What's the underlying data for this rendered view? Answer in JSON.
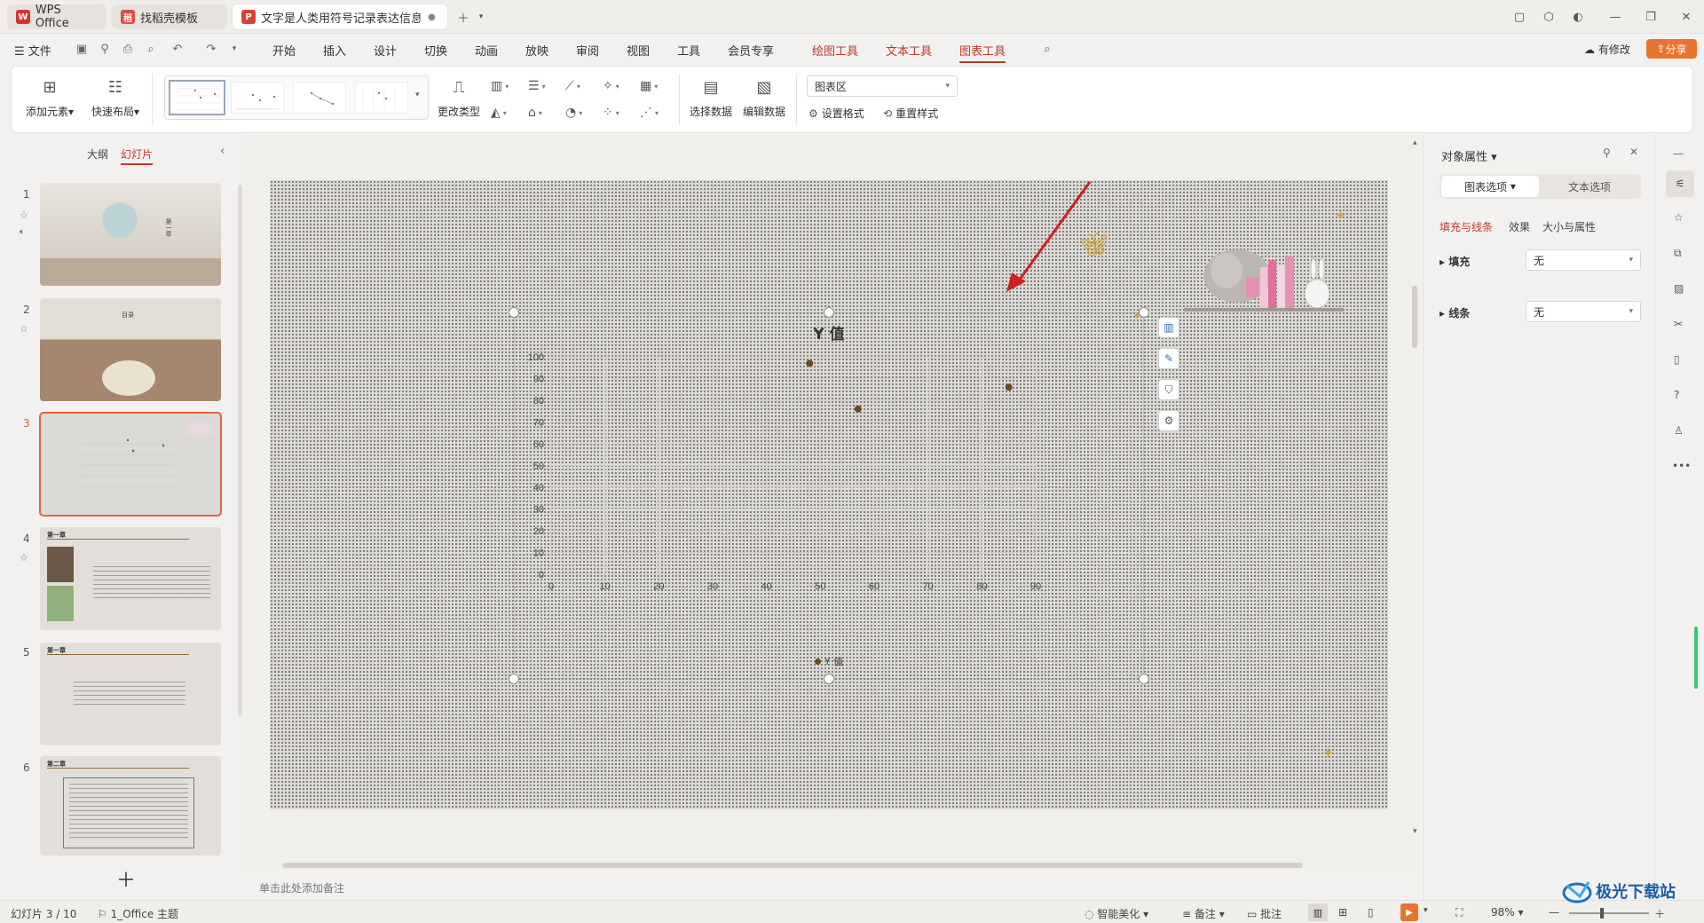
{
  "titlebar": {
    "tabs": [
      {
        "label": "WPS Office"
      },
      {
        "label": "找稻壳模板"
      },
      {
        "label": "文字是人类用符号记录表达信息以"
      }
    ]
  },
  "menubar": {
    "file": "文件",
    "items": [
      "开始",
      "插入",
      "设计",
      "切换",
      "动画",
      "放映",
      "审阅",
      "视图",
      "工具",
      "会员专享"
    ],
    "context_items": [
      "绘图工具",
      "文本工具",
      "图表工具"
    ],
    "modified": "有修改",
    "share": "分享"
  },
  "ribbon": {
    "add_element": "添加元素",
    "quick_layout": "快速布局",
    "change_type": "更改类型",
    "select_data": "选择数据",
    "edit_data": "编辑数据",
    "chart_area_select": "图表区",
    "set_format": "设置格式",
    "reset_style": "重置样式"
  },
  "leftpanel": {
    "tab_outline": "大纲",
    "tab_slides": "幻灯片",
    "slide_numbers": [
      "1",
      "2",
      "3",
      "4",
      "5",
      "6"
    ],
    "thumb1_title": "第一章",
    "thumb2_title": "目录",
    "thumb4_title": "第一章",
    "thumb5_title": "第一章",
    "thumb6_title": "第二章"
  },
  "chart_data": {
    "type": "scatter",
    "title": "Y 值",
    "series": [
      {
        "name": "Y 值",
        "x": [
          48,
          57,
          85
        ],
        "y": [
          97,
          76,
          86
        ]
      }
    ],
    "xlim": [
      0,
      90
    ],
    "ylim": [
      0,
      100
    ],
    "x_ticks": [
      "0",
      "10",
      "20",
      "30",
      "40",
      "50",
      "60",
      "70",
      "80",
      "90"
    ],
    "y_ticks": [
      "100",
      "90",
      "80",
      "70",
      "60",
      "50",
      "40",
      "30",
      "20",
      "10",
      "0"
    ],
    "legend_position": "bottom",
    "grid": true,
    "marker_color": "#6b4a1f"
  },
  "notes_placeholder": "单击此处添加备注",
  "rightpane": {
    "title": "对象属性",
    "tab_chart": "图表选项",
    "tab_text": "文本选项",
    "subtab_fill": "填充与线条",
    "subtab_effect": "效果",
    "subtab_size": "大小与属性",
    "fill_label": "填充",
    "fill_value": "无",
    "line_label": "线条",
    "line_value": "无"
  },
  "statusbar": {
    "slide_info": "幻灯片 3 / 10",
    "theme": "1_Office 主题",
    "smart": "智能美化",
    "notes": "备注",
    "comments": "批注",
    "zoom": "98%"
  },
  "watermark": "极光下载站",
  "colors": {
    "accent": "#c0392b",
    "share_bg": "#e8742f",
    "selected_border": "#e5623a"
  }
}
